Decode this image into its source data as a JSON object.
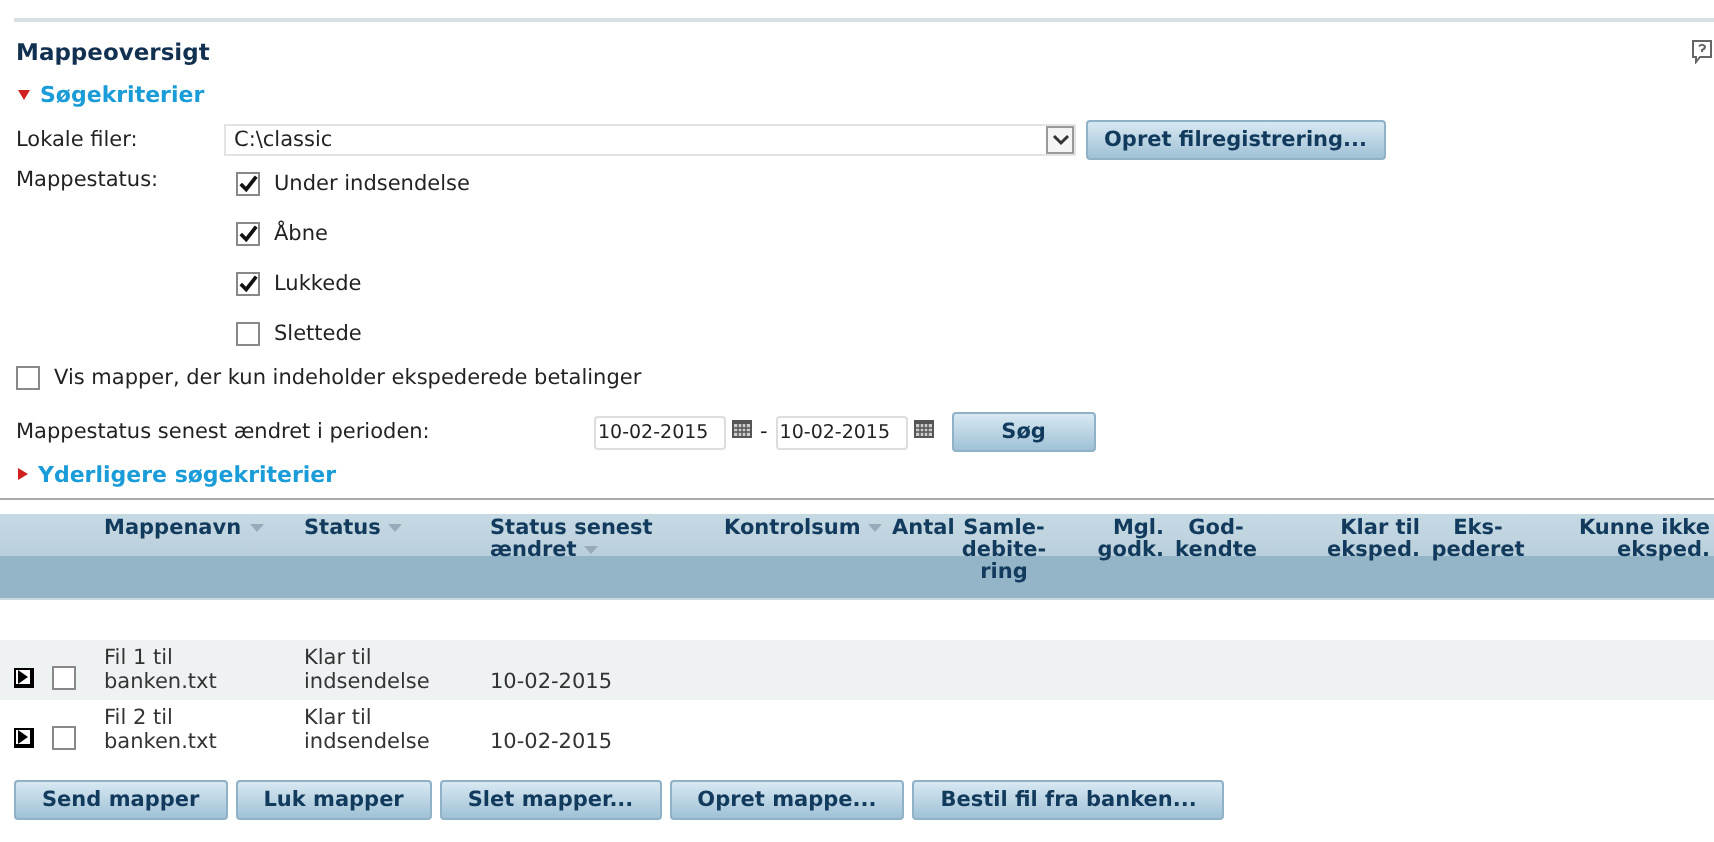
{
  "title": "Mappeoversigt",
  "search_section": {
    "label": "Søgekriterier",
    "expanded": true
  },
  "local_files": {
    "label": "Lokale filer:",
    "value": "C:\\classic",
    "button": "Opret filregistrering..."
  },
  "folder_status": {
    "label": "Mappestatus:",
    "options": [
      {
        "label": "Under indsendelse",
        "checked": true
      },
      {
        "label": "Åbne",
        "checked": true
      },
      {
        "label": "Lukkede",
        "checked": true
      },
      {
        "label": "Slettede",
        "checked": false
      }
    ]
  },
  "only_expedited": {
    "label": "Vis mapper, der kun indeholder ekspederede betalinger",
    "checked": false
  },
  "period": {
    "label": "Mappestatus senest ændret i perioden:",
    "from": "10-02-2015",
    "separator": "-",
    "to": "10-02-2015",
    "button": "Søg"
  },
  "more_criteria": {
    "label": "Yderligere søgekriterier",
    "expanded": false
  },
  "table": {
    "columns": [
      {
        "label": "Mappenavn",
        "sortable": true
      },
      {
        "label": "Status",
        "sortable": true
      },
      {
        "label": "Status senest ændret",
        "sortable": true
      },
      {
        "label": "Kontrolsum",
        "sortable": true
      },
      {
        "label": "Antal",
        "sortable": false
      },
      {
        "label": "Samle-debite-ring",
        "sortable": false
      },
      {
        "label": "Mgl. godk.",
        "sortable": false
      },
      {
        "label": "God-kendte",
        "sortable": false
      },
      {
        "label": "Klar til eksped.",
        "sortable": false
      },
      {
        "label": "Eks-pederet",
        "sortable": false
      },
      {
        "label": "Kunne ikke eksped.",
        "sortable": false
      }
    ],
    "rows": [
      {
        "checked": false,
        "name": "Fil 1 til banken.txt",
        "status": "Klar til indsendelse",
        "changed": "10-02-2015"
      },
      {
        "checked": false,
        "name": "Fil 2 til banken.txt",
        "status": "Klar til indsendelse",
        "changed": "10-02-2015"
      }
    ]
  },
  "buttons": [
    "Send mapper",
    "Luk mapper",
    "Slet mapper...",
    "Opret mappe...",
    "Bestil fil fra banken..."
  ]
}
